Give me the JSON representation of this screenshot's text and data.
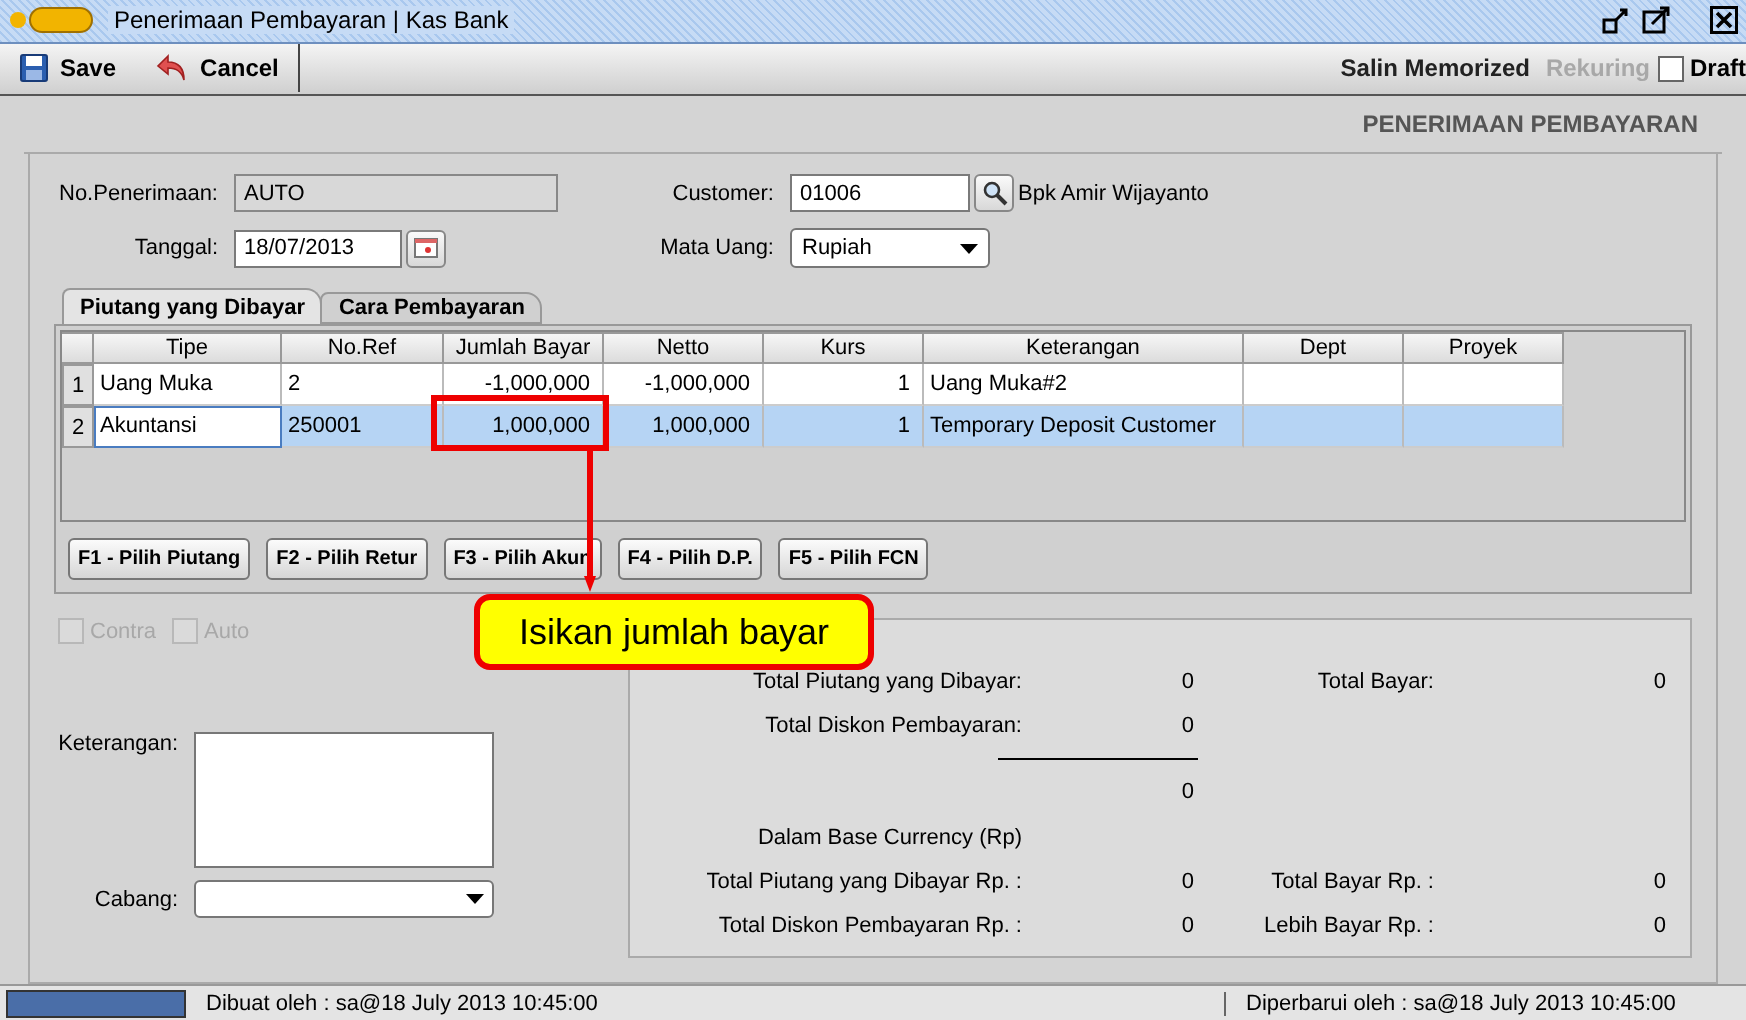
{
  "window": {
    "title": "Penerimaan Pembayaran | Kas Bank"
  },
  "toolbar": {
    "buttons": [
      {
        "label": "Save",
        "kind": "save"
      },
      {
        "label": "Cancel",
        "kind": "cancel"
      }
    ],
    "actions": [
      {
        "label": "Salin Memorized",
        "disabled": false
      },
      {
        "label": "Rekuring",
        "disabled": true
      }
    ],
    "draft": {
      "label": "Draft",
      "checked": false
    }
  },
  "form_title": "PENERIMAAN PEMBAYARAN",
  "header": {
    "no_penerimaan": {
      "label": "No.Penerimaan:",
      "value": "AUTO"
    },
    "tanggal": {
      "label": "Tanggal:",
      "value": "18/07/2013"
    },
    "customer": {
      "label": "Customer:",
      "value": "01006",
      "name": "Bpk Amir Wijayanto"
    },
    "mata_uang": {
      "label": "Mata Uang:",
      "value": "Rupiah"
    }
  },
  "tabs": [
    {
      "label": "Piutang yang Dibayar",
      "selected": true
    },
    {
      "label": "Cara Pembayaran",
      "selected": false
    }
  ],
  "table": {
    "columns": [
      "Tipe",
      "No.Ref",
      "Jumlah Bayar",
      "Netto",
      "Kurs",
      "Keterangan",
      "Dept",
      "Proyek"
    ],
    "rows": [
      {
        "number": "1",
        "selected": false,
        "cells": [
          "Uang Muka",
          "2",
          "-1,000,000",
          "-1,000,000",
          "1",
          "Uang Muka#2",
          "",
          ""
        ]
      },
      {
        "number": "2",
        "selected": true,
        "cells": [
          "Akuntansi",
          "250001",
          "1,000,000",
          "1,000,000",
          "1",
          "Temporary Deposit Customer",
          "",
          ""
        ]
      }
    ]
  },
  "pick_buttons": [
    "F1 - Pilih Piutang",
    "F2 - Pilih Retur",
    "F3 - Pilih Akun",
    "F4 - Pilih D.P.",
    "F5 - Pilih FCN"
  ],
  "options": [
    {
      "label": "Contra",
      "checked": false,
      "disabled": true
    },
    {
      "label": "Auto",
      "checked": false,
      "disabled": true
    }
  ],
  "keterangan": {
    "label": "Keterangan:"
  },
  "cabang": {
    "label": "Cabang:"
  },
  "summary": [
    {
      "kind": "pair",
      "label": "Total Piutang yang Dibayar:",
      "value": "0",
      "label2": "Total Bayar:",
      "value2": "0"
    },
    {
      "kind": "single",
      "label": "Total Diskon Pembayaran:",
      "value": "0"
    },
    {
      "kind": "rule"
    },
    {
      "kind": "total",
      "value": "0"
    },
    {
      "kind": "heading",
      "label": "Dalam Base Currency (Rp)"
    },
    {
      "kind": "pair",
      "label": "Total Piutang yang Dibayar Rp. :",
      "value": "0",
      "label2": "Total Bayar Rp. :",
      "value2": "0"
    },
    {
      "kind": "pair",
      "label": "Total Diskon Pembayaran Rp. :",
      "value": "0",
      "label2": "Lebih Bayar Rp. :",
      "value2": "0"
    }
  ],
  "callout": "Isikan jumlah bayar",
  "status_bar": {
    "created": "Dibuat oleh : sa@18 July 2013  10:45:00",
    "updated": "Diperbarui oleh : sa@18 July 2013  10:45:00"
  }
}
